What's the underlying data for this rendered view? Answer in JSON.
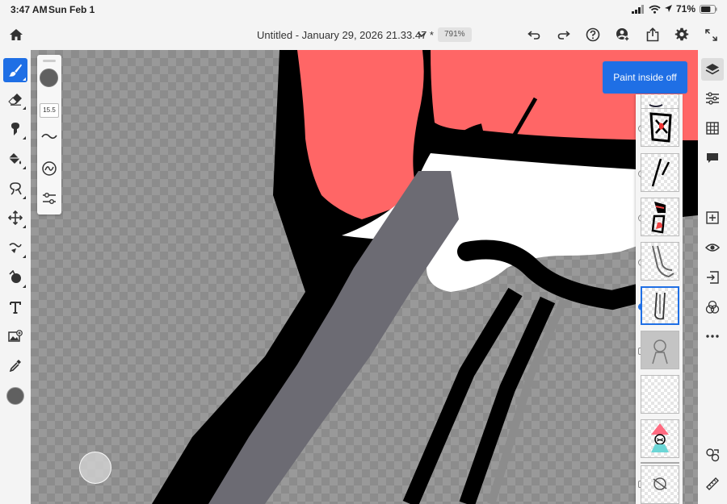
{
  "status_bar": {
    "time": "3:47 AM",
    "date": "Sun Feb 1",
    "battery_percent": "71%",
    "battery_level": 0.71
  },
  "document": {
    "title": "Untitled - January 29, 2026 21.33.47 *",
    "zoom": "791%"
  },
  "brush": {
    "size": "15.5",
    "color": "#606060"
  },
  "toast": {
    "text": "Paint inside off"
  },
  "left_tools": [
    {
      "name": "paint-brush-tool",
      "icon": "brush-icon",
      "active": true
    },
    {
      "name": "eraser-tool",
      "icon": "eraser-icon",
      "active": false
    },
    {
      "name": "smudge-tool",
      "icon": "smudge-icon",
      "active": false
    },
    {
      "name": "fill-tool",
      "icon": "paint-bucket-icon",
      "active": false
    },
    {
      "name": "lasso-tool",
      "icon": "lasso-icon",
      "active": false
    },
    {
      "name": "move-tool",
      "icon": "move-icon",
      "active": false
    },
    {
      "name": "liquify-tool",
      "icon": "liquify-icon",
      "active": false
    },
    {
      "name": "shape-tool",
      "icon": "shape-icon",
      "active": false
    },
    {
      "name": "text-tool",
      "icon": "text-icon",
      "active": false
    },
    {
      "name": "image-tool",
      "icon": "image-icon",
      "active": false
    },
    {
      "name": "eyedropper-tool",
      "icon": "eyedropper-icon",
      "active": false
    }
  ],
  "colors": {
    "accent": "#1f6fe5",
    "current_color": "#606060",
    "fill_red": "#ff6666",
    "fill_gray": "#6c6b73",
    "outline": "#000000"
  }
}
